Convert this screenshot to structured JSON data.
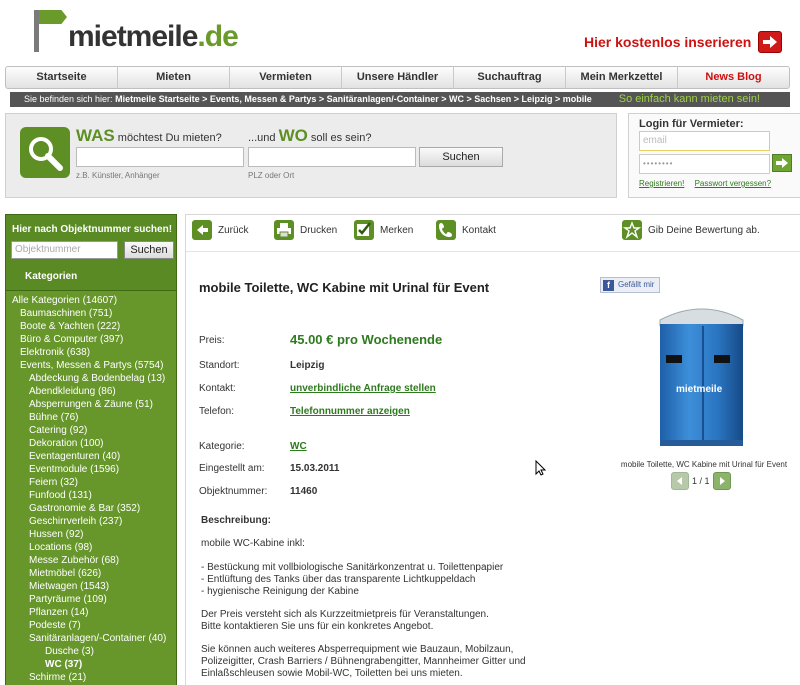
{
  "header": {
    "logo_main": "mietmeile",
    "logo_tld": ".de",
    "insert_link": "Hier kostenlos inserieren"
  },
  "nav": [
    {
      "label": "Startseite"
    },
    {
      "label": "Mieten"
    },
    {
      "label": "Vermieten"
    },
    {
      "label": "Unsere Händler"
    },
    {
      "label": "Suchauftrag"
    },
    {
      "label": "Mein Merkzettel"
    },
    {
      "label": "News Blog"
    }
  ],
  "breadcrumb": {
    "prefix": "Sie befinden sich hier:",
    "path": "Mietmeile Startseite > Events, Messen & Partys > Sanitäranlagen/-Container > WC > Sachsen > Leipzig > mobile",
    "slogan": "So einfach kann mieten sein!"
  },
  "search": {
    "was_big": "WAS",
    "was_text": " möchtest Du mieten?",
    "wo_prefix": "...und ",
    "wo_big": "WO",
    "wo_text": " soll es sein?",
    "was_hint": "z.B. Künstler, Anhänger",
    "wo_hint": "PLZ oder Ort",
    "button": "Suchen"
  },
  "login": {
    "title": "Login für Vermieter:",
    "email_placeholder": "email",
    "password_mask": "••••••••",
    "register": "Registrieren!",
    "forgot": "Passwort vergessen?"
  },
  "sidebar": {
    "head": "Hier nach Objektnummer suchen!",
    "input_placeholder": "Objektnummer",
    "button": "Suchen",
    "kat_head": "Kategorien",
    "items": [
      {
        "label": "Alle Kategorien (14607)",
        "level": 0
      },
      {
        "label": "Baumaschinen (751)",
        "level": 1
      },
      {
        "label": "Boote & Yachten (222)",
        "level": 1
      },
      {
        "label": "Büro & Computer (397)",
        "level": 1
      },
      {
        "label": "Elektronik (638)",
        "level": 1
      },
      {
        "label": "Events, Messen & Partys (5754)",
        "level": 1
      },
      {
        "label": "Abdeckung & Bodenbelag (13)",
        "level": 2
      },
      {
        "label": "Abendkleidung (86)",
        "level": 2
      },
      {
        "label": "Absperrungen & Zäune (51)",
        "level": 2
      },
      {
        "label": "Bühne (76)",
        "level": 2
      },
      {
        "label": "Catering (92)",
        "level": 2
      },
      {
        "label": "Dekoration (100)",
        "level": 2
      },
      {
        "label": "Eventagenturen (40)",
        "level": 2
      },
      {
        "label": "Eventmodule (1596)",
        "level": 2
      },
      {
        "label": "Feiern (32)",
        "level": 2
      },
      {
        "label": "Funfood (131)",
        "level": 2
      },
      {
        "label": "Gastronomie & Bar (352)",
        "level": 2
      },
      {
        "label": "Geschirrverleih (237)",
        "level": 2
      },
      {
        "label": "Hussen (92)",
        "level": 2
      },
      {
        "label": "Locations (98)",
        "level": 2
      },
      {
        "label": "Messe Zubehör (68)",
        "level": 2
      },
      {
        "label": "Mietmöbel (626)",
        "level": 2
      },
      {
        "label": "Mietwagen (1543)",
        "level": 2
      },
      {
        "label": "Partyräume (109)",
        "level": 2
      },
      {
        "label": "Pflanzen (14)",
        "level": 2
      },
      {
        "label": "Podeste (7)",
        "level": 2
      },
      {
        "label": "Sanitäranlagen/-Container (40)",
        "level": 2
      },
      {
        "label": "Dusche (3)",
        "level": 3
      },
      {
        "label": "WC (37)",
        "level": 3,
        "active": true
      },
      {
        "label": "Schirme (21)",
        "level": 2
      }
    ]
  },
  "toolbar": {
    "back": "Zurück",
    "print": "Drucken",
    "bookmark": "Merken",
    "contact": "Kontakt",
    "rate": "Gib Deine Bewertung ab."
  },
  "listing": {
    "title": "mobile Toilette, WC Kabine mit Urinal für Event",
    "fb_like": "Gefällt mir",
    "price_label": "Preis:",
    "price": "45.00 € pro Wochenende",
    "location_label": "Standort:",
    "location": "Leipzig",
    "contact_label": "Kontakt:",
    "contact": "unverbindliche Anfrage stellen",
    "phone_label": "Telefon:",
    "phone": "Telefonnummer anzeigen",
    "category_label": "Kategorie:",
    "category": "WC",
    "posted_label": "Eingestellt am:",
    "posted": "15.03.2011",
    "number_label": "Objektnummer:",
    "number": "11460",
    "image_caption": "mobile Toilette, WC Kabine mit Urinal für Event",
    "image_logo": "mietmeile",
    "pager": "1 / 1",
    "desc_head": "Beschreibung:",
    "desc_intro": "mobile WC-Kabine inkl:",
    "desc_b1": "- Bestückung mit vollbiologische Sanitärkonzentrat u. Toilettenpapier",
    "desc_b2": "- Entlüftung des Tanks über das transparente Lichtkuppeldach",
    "desc_b3": "- hygienische Reinigung der Kabine",
    "desc_p2a": "Der Preis versteht sich als Kurzzeitmietpreis für Veranstaltungen.",
    "desc_p2b": "Bitte kontaktieren Sie uns für ein konkretes Angebot.",
    "desc_p3a": "Sie können auch weiteres Absperrequipment wie Bauzaun, Mobilzaun,",
    "desc_p3b": "Polizeigitter, Crash Barriers / Bühnengrabengitter, Mannheimer Gitter und",
    "desc_p3c": "Einlaßschleusen sowie Mobil-WC, Toiletten bei uns mieten."
  },
  "colors": {
    "brand_green": "#5d8f25",
    "sidebar_green": "#67962b",
    "link_green": "#2e7a1e",
    "accent_red": "#cc1111"
  }
}
